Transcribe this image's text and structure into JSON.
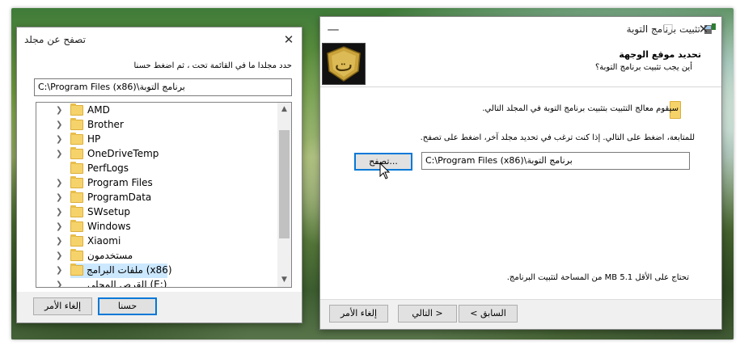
{
  "browse_dialog": {
    "title": "تصفح عن مجلد",
    "close_symbol": "✕",
    "instruction": "حدد مجلدا ما في القائمة تحت ، ثم اضغط حسنا",
    "path_value": "C:\\Program Files (x86)\\برنامج التوبة",
    "tree_items": [
      {
        "label": "AMD"
      },
      {
        "label": "Brother"
      },
      {
        "label": "HP"
      },
      {
        "label": "OneDriveTemp"
      },
      {
        "label": "PerfLogs"
      },
      {
        "label": "Program Files"
      },
      {
        "label": "ProgramData"
      },
      {
        "label": "SWsetup"
      },
      {
        "label": "Windows"
      },
      {
        "label": "Xiaomi"
      },
      {
        "label": "مستخدمون"
      },
      {
        "label": "ملفات البرامج (x86)"
      },
      {
        "label": "القرص المحلي (E:)"
      }
    ],
    "ok_label": "حسنا",
    "cancel_label": "إلغاء الأمر"
  },
  "installer": {
    "title": "تثبيت برنامج التوبة",
    "minimize_symbol": "—",
    "maximize_symbol": "☐",
    "close_symbol": "✕",
    "header_title": "تحديد موقع الوجهة",
    "header_subtitle": "أين يجب تثبيت برنامج التوبة؟",
    "logo_glyph": "ت",
    "line1": "سيقوم معالج التثبيت بتثبيت  برنامج التوبة في المجلد التالي.",
    "line2": "للمتابعة، اضغط على التالي. إذا كنت ترغب في تحديد مجلد آخر، اضغط على تصفح.",
    "browse_label": "تصفح...",
    "path_value": "C:\\Program Files (x86)\\برنامج التوبة",
    "space_note": "تحتاج على الأقل MB 5.1 من المساحة لتثبيت البرنامج.",
    "back_label": "< السابق",
    "next_label": "التالي >",
    "cancel_label": "إلغاء الأمر"
  },
  "colors": {
    "accent": "#0078d7",
    "selection": "#cce8ff",
    "folder": "#f6d36a",
    "logo_gold": "#c9a23a"
  }
}
